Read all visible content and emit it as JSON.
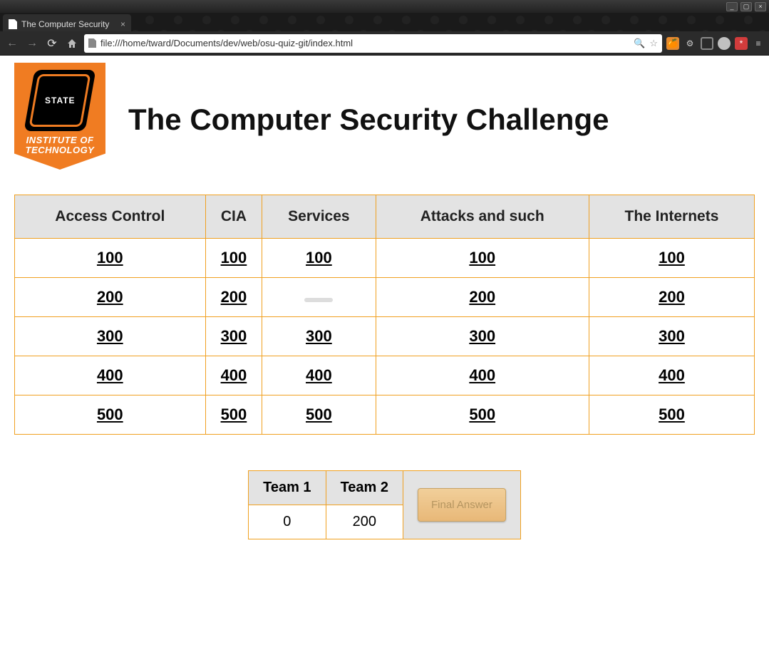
{
  "window": {
    "min_label": "_",
    "max_label": "▢",
    "close_label": "×"
  },
  "browser": {
    "tab_title": "The Computer Security",
    "tab_close": "×",
    "back": "←",
    "forward": "→",
    "reload": "⟳",
    "url": "file:///home/tward/Documents/dev/web/osu-quiz-git/index.html",
    "zoom_icon": "🔍",
    "star": "☆",
    "ext_orange": "🍊",
    "ext_gear": "⚙",
    "ext_red": "*",
    "ext_menu": "≡"
  },
  "logo": {
    "state_text": "STATE",
    "institute_line1": "INSTITUTE OF",
    "institute_line2": "TECHNOLOGY"
  },
  "page": {
    "title": "The Computer Security Challenge"
  },
  "board": {
    "categories": [
      "Access Control",
      "CIA",
      "Services",
      "Attacks and such",
      "The Internets"
    ],
    "rows": [
      [
        {
          "v": "100"
        },
        {
          "v": "100"
        },
        {
          "v": "100"
        },
        {
          "v": "100"
        },
        {
          "v": "100"
        }
      ],
      [
        {
          "v": "200"
        },
        {
          "v": "200"
        },
        {
          "v": "",
          "used": true
        },
        {
          "v": "200"
        },
        {
          "v": "200"
        }
      ],
      [
        {
          "v": "300"
        },
        {
          "v": "300"
        },
        {
          "v": "300"
        },
        {
          "v": "300"
        },
        {
          "v": "300"
        }
      ],
      [
        {
          "v": "400"
        },
        {
          "v": "400"
        },
        {
          "v": "400"
        },
        {
          "v": "400"
        },
        {
          "v": "400"
        }
      ],
      [
        {
          "v": "500"
        },
        {
          "v": "500"
        },
        {
          "v": "500"
        },
        {
          "v": "500"
        },
        {
          "v": "500"
        }
      ]
    ]
  },
  "score": {
    "team1_label": "Team 1",
    "team2_label": "Team 2",
    "team1_score": "0",
    "team2_score": "200",
    "final_button": "Final Answer"
  }
}
